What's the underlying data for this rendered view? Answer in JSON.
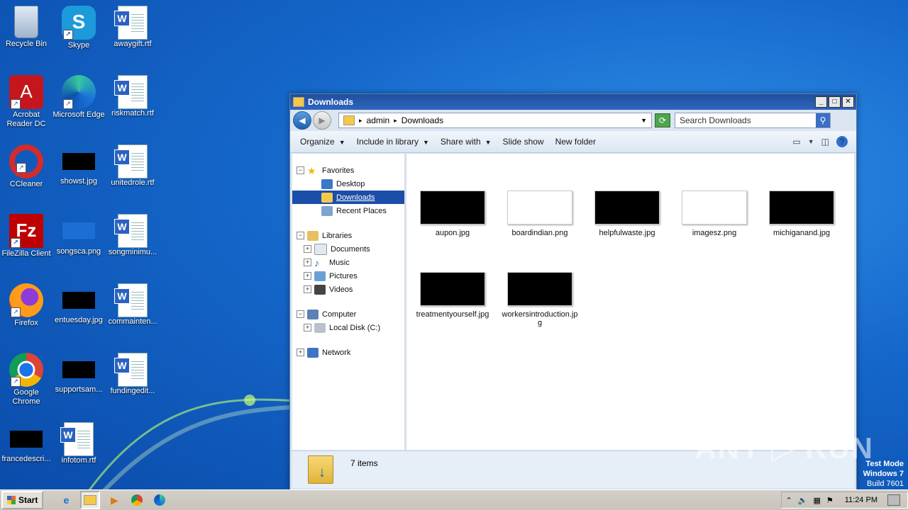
{
  "desktop_icons": [
    {
      "label": "Recycle Bin"
    },
    {
      "label": "Skype"
    },
    {
      "label": "awaygift.rtf"
    },
    {
      "label": "Acrobat Reader DC"
    },
    {
      "label": "Microsoft Edge"
    },
    {
      "label": "riskmatch.rtf"
    },
    {
      "label": "CCleaner"
    },
    {
      "label": "showst.jpg"
    },
    {
      "label": "unitedrole.rtf"
    },
    {
      "label": "FileZilla Client"
    },
    {
      "label": "songsca.png"
    },
    {
      "label": "songminimu..."
    },
    {
      "label": "Firefox"
    },
    {
      "label": "entuesday.jpg"
    },
    {
      "label": "commainten..."
    },
    {
      "label": "Google Chrome"
    },
    {
      "label": "supportsam..."
    },
    {
      "label": "fundingedit..."
    },
    {
      "label": "francedescri..."
    },
    {
      "label": "infotom.rtf"
    }
  ],
  "window": {
    "title": "Downloads",
    "title_buttons": {
      "min": "_",
      "max": "□",
      "close": "✕"
    },
    "address": {
      "path_1": "admin",
      "path_2": "Downloads",
      "sep": "▸"
    },
    "search_placeholder": "Search Downloads",
    "toolbar": {
      "organize": "Organize",
      "include": "Include in library",
      "share": "Share with",
      "slideshow": "Slide show",
      "newfolder": "New folder"
    },
    "nav": {
      "favorites": "Favorites",
      "desktop": "Desktop",
      "downloads": "Downloads",
      "recent": "Recent Places",
      "libraries": "Libraries",
      "documents": "Documents",
      "music": "Music",
      "pictures": "Pictures",
      "videos": "Videos",
      "computer": "Computer",
      "localdisk": "Local Disk (C:)",
      "network": "Network"
    },
    "files": [
      {
        "name": "aupon.jpg"
      },
      {
        "name": "boardindian.png"
      },
      {
        "name": "helpfulwaste.jpg"
      },
      {
        "name": "imagesz.png"
      },
      {
        "name": "michiganand.jpg"
      },
      {
        "name": "treatmentyourself.jpg"
      },
      {
        "name": "workersintroduction.jpg"
      }
    ],
    "status_count": "7 items"
  },
  "taskbar": {
    "start": "Start",
    "time": "11:24 PM"
  },
  "watermark": "ANY ▷ RUN",
  "testmode": {
    "line1": "Test Mode",
    "line2": "Windows 7",
    "line3": "Build 7601"
  },
  "colors": {
    "titlebar": "#1f4e9c",
    "selection": "#1b4ea8",
    "desktop": "#1466c9"
  }
}
